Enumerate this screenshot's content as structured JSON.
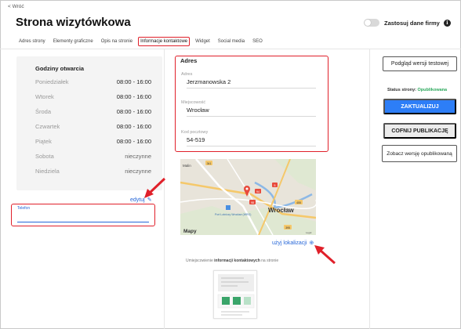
{
  "nav": {
    "back_label": "< Wróć"
  },
  "header": {
    "title": "Strona wizytówkowa",
    "apply_company_label": "Zastosuj dane firmy",
    "info_icon": "i"
  },
  "tabs": [
    {
      "label": "Adres strony"
    },
    {
      "label": "Elementy graficzne"
    },
    {
      "label": "Opis na stronie"
    },
    {
      "label": "Informacje kontaktowe",
      "active": true
    },
    {
      "label": "Widget"
    },
    {
      "label": "Social media"
    },
    {
      "label": "SEO"
    }
  ],
  "hours": {
    "title": "Godziny otwarcia",
    "rows": [
      {
        "day": "Poniedziałek",
        "time": "08:00 - 16:00"
      },
      {
        "day": "Wtorek",
        "time": "08:00 - 16:00"
      },
      {
        "day": "Środa",
        "time": "08:00 - 16:00"
      },
      {
        "day": "Czwartek",
        "time": "08:00 - 16:00"
      },
      {
        "day": "Piątek",
        "time": "08:00 - 16:00"
      },
      {
        "day": "Sobota",
        "time": "nieczynne"
      },
      {
        "day": "Niedziela",
        "time": "nieczynne"
      }
    ],
    "edit_label": "edytuj"
  },
  "phone": {
    "label": "Telefon",
    "value": ""
  },
  "address": {
    "title": "Adres",
    "fields": [
      {
        "label": "Adres",
        "value": "Jerzmanowska 2"
      },
      {
        "label": "Miejscowość",
        "value": "Wrocław"
      },
      {
        "label": "Kod pocztowy",
        "value": "54-519"
      }
    ]
  },
  "map": {
    "labels": {
      "city": "Wrocław",
      "town": "Malin",
      "airport": "Port Lotniczy Wrocław (WRO)",
      "brand": "Mapy",
      "legal": "Legal"
    },
    "route_numbers": [
      "341",
      "5",
      "94",
      "98",
      "455",
      "395"
    ],
    "use_location_label": "użyj lokalizacji"
  },
  "placement": {
    "prefix": "Umiejscowienie ",
    "bold": "informacji kontaktowych",
    "suffix": " na stronie"
  },
  "sidebar": {
    "preview_test_label": "Podgląd wersji testowej",
    "status_label": "Status strony:",
    "status_value": "Opublikowana",
    "update_label": "ZAKTUALIZUJ",
    "unpublish_label": "COFNIJ PUBLIKACJĘ",
    "view_published_label": "Zobacz wersję opublikowaną"
  },
  "colors": {
    "accent_blue": "#2d7ef7",
    "link_blue": "#2566d8",
    "highlight_red": "#e0202a",
    "status_green": "#2aa85b"
  }
}
